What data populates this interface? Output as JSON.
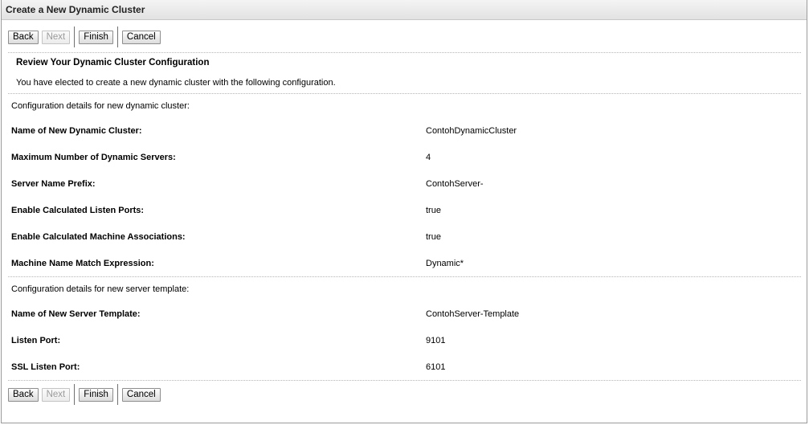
{
  "panel": {
    "title": "Create a New Dynamic Cluster"
  },
  "buttons": {
    "back": "Back",
    "next": "Next",
    "finish": "Finish",
    "cancel": "Cancel"
  },
  "review": {
    "heading": "Review Your Dynamic Cluster Configuration",
    "intro": "You have elected to create a new dynamic cluster with the following configuration."
  },
  "cluster_section": {
    "label": "Configuration details for new dynamic cluster:",
    "rows": [
      {
        "label": "Name of New Dynamic Cluster:",
        "value": "ContohDynamicCluster"
      },
      {
        "label": "Maximum Number of Dynamic Servers:",
        "value": "4"
      },
      {
        "label": "Server Name Prefix:",
        "value": "ContohServer-"
      },
      {
        "label": "Enable Calculated Listen Ports:",
        "value": "true"
      },
      {
        "label": "Enable Calculated Machine Associations:",
        "value": "true"
      },
      {
        "label": "Machine Name Match Expression:",
        "value": "Dynamic*"
      }
    ]
  },
  "template_section": {
    "label": "Configuration details for new server template:",
    "rows": [
      {
        "label": "Name of New Server Template:",
        "value": "ContohServer-Template"
      },
      {
        "label": "Listen Port:",
        "value": "9101"
      },
      {
        "label": "SSL Listen Port:",
        "value": "6101"
      }
    ]
  }
}
